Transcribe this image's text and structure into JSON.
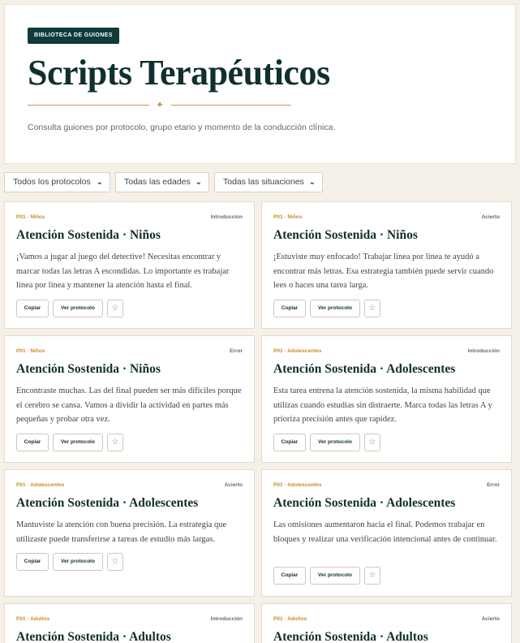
{
  "header": {
    "badge": "BIBLIOTECA DE GUIONES",
    "title": "Scripts Terapéuticos",
    "subtitle": "Consulta guiones por protocolo, grupo etario y momento de la conducción clínica."
  },
  "filters": {
    "protocol": "Todos los protocolos",
    "age": "Todas las edades",
    "situation": "Todas las situaciones"
  },
  "buttons": {
    "copy": "Copiar",
    "view": "Ver protocolo",
    "star": "☆"
  },
  "cards": [
    {
      "tag": "P01 · Niños",
      "moment": "Introducción",
      "title": "Atención Sostenida · Niños",
      "body": "¡Vamos a jugar al juego del detective! Necesitas encontrar y marcar todas las letras A escondidas. Lo importante es trabajar línea por línea y mantener la atención hasta el final."
    },
    {
      "tag": "P01 · Niños",
      "moment": "Acierto",
      "title": "Atención Sostenida · Niños",
      "body": "¡Estuviste muy enfocado! Trabajar línea por línea te ayudó a encontrar más letras. Esa estrategia también puede servir cuando lees o haces una tarea larga."
    },
    {
      "tag": "P01 · Niños",
      "moment": "Error",
      "title": "Atención Sostenida · Niños",
      "body": "Encontraste muchas. Las del final pueden ser más difíciles porque el cerebro se cansa. Vamos a dividir la actividad en partes más pequeñas y probar otra vez."
    },
    {
      "tag": "P01 · Adolescentes",
      "moment": "Introducción",
      "title": "Atención Sostenida · Adolescentes",
      "body": "Esta tarea entrena la atención sostenida, la misma habilidad que utilizas cuando estudias sin distraerte. Marca todas las letras A y prioriza precisión antes que rapidez."
    },
    {
      "tag": "P01 · Adolescentes",
      "moment": "Acierto",
      "title": "Atención Sostenida · Adolescentes",
      "body": "Mantuviste la atención con buena precisión. La estrategia que utilizaste puede transferirse a tareas de estudio más largas."
    },
    {
      "tag": "P01 · Adolescentes",
      "moment": "Error",
      "title": "Atención Sostenida · Adolescentes",
      "body": "Las omisiones aumentaron hacia el final. Podemos trabajar en bloques y realizar una verificación intencional antes de continuar."
    },
    {
      "tag": "P01 · Adultos",
      "moment": "Introducción",
      "title": "Atención Sostenida · Adultos",
      "body": ""
    },
    {
      "tag": "P01 · Adultos",
      "moment": "Acierto",
      "title": "Atención Sostenida · Adultos",
      "body": ""
    }
  ]
}
